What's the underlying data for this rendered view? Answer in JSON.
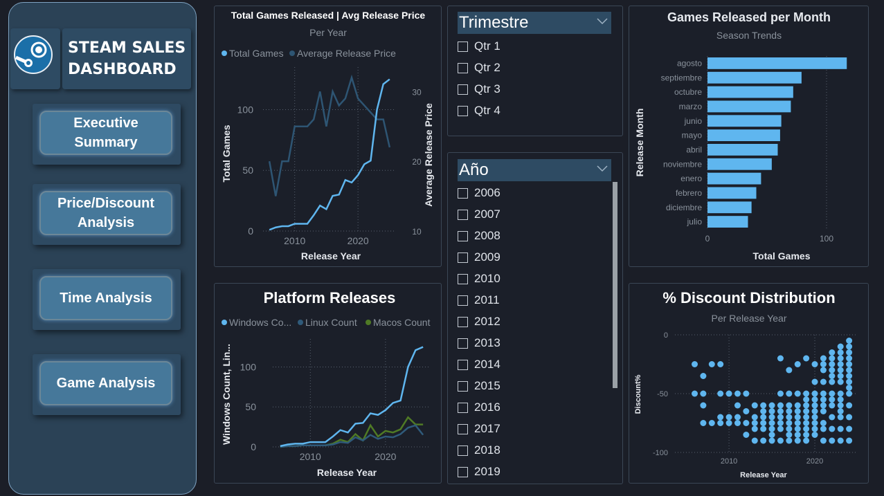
{
  "sidebar": {
    "logo_icon": "steam-logo-icon",
    "title": "STEAM SALES\nDASHBOARD",
    "nav": [
      {
        "label": "Executive Summary"
      },
      {
        "label": "Price/Discount Analysis"
      },
      {
        "label": "Time Analysis"
      },
      {
        "label": "Game Analysis"
      }
    ]
  },
  "trimestre": {
    "title": "Trimestre",
    "options": [
      "Qtr 1",
      "Qtr 2",
      "Qtr 3",
      "Qtr 4"
    ]
  },
  "anio": {
    "title": "Año",
    "options": [
      "2006",
      "2007",
      "2008",
      "2009",
      "2010",
      "2011",
      "2012",
      "2013",
      "2014",
      "2015",
      "2016",
      "2017",
      "2018",
      "2019"
    ]
  },
  "colors": {
    "total": "#5fb6ef",
    "price": "#2e5573",
    "windows": "#5fb6ef",
    "linux": "#2f5a7a",
    "macos": "#4f7a25",
    "accent_header": "#2e4b63"
  },
  "chart_data": [
    {
      "id": "total_games_price",
      "type": "line",
      "title": "Total Games Released | Avg Release Price",
      "subtitle": "Per Year",
      "xlabel": "Release Year",
      "ylabel": "Total Games",
      "ylabel2": "Average Release Price",
      "xlim": [
        2005,
        2026
      ],
      "ylim": [
        0,
        135
      ],
      "y2lim": [
        10,
        33.5
      ],
      "xticks": [
        "2010",
        "2020"
      ],
      "yticks": [
        "0",
        "50",
        "100"
      ],
      "y2ticks": [
        "10",
        "20",
        "30"
      ],
      "legend": [
        "Total Games",
        "Average Release Price"
      ],
      "legend_position": "top",
      "series": [
        {
          "name": "Total Games",
          "axis": "left",
          "x": [
            2006,
            2007,
            2008,
            2009,
            2010,
            2011,
            2012,
            2013,
            2014,
            2015,
            2016,
            2017,
            2018,
            2019,
            2020,
            2021,
            2022,
            2023,
            2024,
            2025
          ],
          "values": [
            1,
            3,
            4,
            4,
            6,
            6,
            6,
            13,
            21,
            18,
            29,
            30,
            42,
            40,
            46,
            55,
            58,
            100,
            121,
            125
          ]
        },
        {
          "name": "Average Release Price",
          "axis": "right",
          "x": [
            2006,
            2007,
            2008,
            2009,
            2010,
            2011,
            2012,
            2013,
            2014,
            2015,
            2016,
            2017,
            2018,
            2019,
            2020,
            2021,
            2022,
            2023,
            2024,
            2025
          ],
          "values": [
            20,
            15,
            20,
            20,
            25,
            25,
            25,
            26,
            30,
            25,
            30,
            28,
            29,
            32,
            29,
            28,
            27,
            26,
            26,
            22
          ]
        }
      ]
    },
    {
      "id": "platform_releases",
      "type": "line",
      "title": "Platform Releases",
      "xlabel": "Release Year",
      "ylabel": "Windows Count, Lin...",
      "xlim": [
        2005,
        2026
      ],
      "ylim": [
        0,
        135
      ],
      "xticks": [
        "2010",
        "2020"
      ],
      "yticks": [
        "0",
        "50",
        "100"
      ],
      "legend": [
        "Windows Co...",
        "Linux Count",
        "Macos Count"
      ],
      "legend_position": "top",
      "series": [
        {
          "name": "Windows Co...",
          "x": [
            2006,
            2007,
            2008,
            2009,
            2010,
            2011,
            2012,
            2013,
            2014,
            2015,
            2016,
            2017,
            2018,
            2019,
            2020,
            2021,
            2022,
            2023,
            2024,
            2025
          ],
          "values": [
            1,
            3,
            4,
            4,
            6,
            6,
            6,
            13,
            21,
            18,
            29,
            30,
            42,
            40,
            46,
            55,
            58,
            100,
            121,
            125
          ]
        },
        {
          "name": "Linux Count",
          "x": [
            2006,
            2007,
            2008,
            2009,
            2010,
            2011,
            2012,
            2013,
            2014,
            2015,
            2016,
            2017,
            2018,
            2019,
            2020,
            2021,
            2022,
            2023,
            2024,
            2025
          ],
          "values": [
            0,
            1,
            1,
            2,
            2,
            2,
            2,
            3,
            6,
            5,
            12,
            8,
            15,
            10,
            13,
            12,
            16,
            24,
            27,
            15
          ]
        },
        {
          "name": "Macos Count",
          "x": [
            2006,
            2007,
            2008,
            2009,
            2010,
            2011,
            2012,
            2013,
            2014,
            2015,
            2016,
            2017,
            2018,
            2019,
            2020,
            2021,
            2022,
            2023,
            2024,
            2025
          ],
          "values": [
            0,
            1,
            1,
            2,
            2,
            2,
            2,
            4,
            9,
            6,
            16,
            8,
            27,
            13,
            20,
            18,
            22,
            37,
            28,
            28
          ]
        }
      ]
    },
    {
      "id": "games_per_month",
      "type": "bar",
      "orientation": "horizontal",
      "title": "Games Released per Month",
      "subtitle": "Season Trends",
      "xlabel": "Total Games",
      "ylabel": "Release Month",
      "xlim": [
        0,
        125
      ],
      "xticks": [
        "0",
        "100"
      ],
      "categories": [
        "agosto",
        "septiembre",
        "octubre",
        "marzo",
        "junio",
        "mayo",
        "abril",
        "noviembre",
        "enero",
        "febrero",
        "diciembre",
        "julio"
      ],
      "values": [
        117,
        79,
        72,
        70,
        62,
        61,
        59,
        54,
        45,
        41,
        37,
        34
      ]
    },
    {
      "id": "discount_distribution",
      "type": "scatter",
      "title": "% Discount Distribution",
      "subtitle": "Per Release Year",
      "xlabel": "Release Year",
      "ylabel": "Discount%",
      "xlim": [
        2003.7,
        2025
      ],
      "ylim": [
        -100,
        0
      ],
      "xticks": [
        "2010",
        "2020"
      ],
      "yticks": [
        "0",
        "-50",
        "-100"
      ],
      "x": [
        2006,
        2006,
        2007,
        2007,
        2007,
        2007,
        2008,
        2008,
        2009,
        2009,
        2009,
        2009,
        2010,
        2010,
        2010,
        2011,
        2011,
        2011,
        2011,
        2012,
        2012,
        2012,
        2012,
        2013,
        2013,
        2013,
        2013,
        2013,
        2014,
        2014,
        2014,
        2014,
        2014,
        2014,
        2015,
        2015,
        2015,
        2015,
        2015,
        2015,
        2015,
        2016,
        2016,
        2016,
        2016,
        2016,
        2016,
        2016,
        2016,
        2017,
        2017,
        2017,
        2017,
        2017,
        2017,
        2017,
        2017,
        2017,
        2018,
        2018,
        2018,
        2018,
        2018,
        2018,
        2018,
        2018,
        2018,
        2019,
        2019,
        2019,
        2019,
        2019,
        2019,
        2019,
        2019,
        2019,
        2019,
        2020,
        2020,
        2020,
        2020,
        2020,
        2020,
        2020,
        2020,
        2020,
        2020,
        2021,
        2021,
        2021,
        2021,
        2021,
        2021,
        2021,
        2021,
        2021,
        2021,
        2021,
        2022,
        2022,
        2022,
        2022,
        2022,
        2022,
        2022,
        2022,
        2022,
        2022,
        2022,
        2022,
        2023,
        2023,
        2023,
        2023,
        2023,
        2023,
        2023,
        2023,
        2023,
        2023,
        2023,
        2023,
        2023,
        2023,
        2024,
        2024,
        2024,
        2024,
        2024,
        2024,
        2024,
        2024,
        2024,
        2024,
        2024,
        2024,
        2024,
        2024
      ],
      "y": [
        -25,
        -50,
        -35,
        -50,
        -60,
        -75,
        -25,
        -75,
        -25,
        -50,
        -70,
        -75,
        -50,
        -70,
        -75,
        -50,
        -60,
        -70,
        -75,
        -50,
        -65,
        -75,
        -85,
        -60,
        -70,
        -75,
        -80,
        -90,
        -60,
        -65,
        -70,
        -75,
        -80,
        -90,
        -60,
        -65,
        -70,
        -75,
        -80,
        -85,
        -90,
        -20,
        -50,
        -60,
        -65,
        -70,
        -75,
        -80,
        -90,
        -30,
        -50,
        -60,
        -65,
        -70,
        -75,
        -80,
        -85,
        -90,
        -25,
        -50,
        -60,
        -65,
        -70,
        -75,
        -80,
        -85,
        -90,
        -20,
        -50,
        -55,
        -60,
        -65,
        -70,
        -75,
        -80,
        -85,
        -90,
        -25,
        -40,
        -50,
        -55,
        -60,
        -65,
        -70,
        -75,
        -80,
        -85,
        -20,
        -25,
        -30,
        -40,
        -50,
        -55,
        -60,
        -65,
        -75,
        -80,
        -90,
        -15,
        -20,
        -25,
        -30,
        -35,
        -40,
        -50,
        -55,
        -60,
        -70,
        -80,
        -90,
        -10,
        -15,
        -20,
        -25,
        -30,
        -35,
        -40,
        -50,
        -55,
        -60,
        -65,
        -70,
        -80,
        -90,
        -5,
        -10,
        -15,
        -20,
        -25,
        -30,
        -35,
        -40,
        -45,
        -50,
        -60,
        -70,
        -80,
        -90
      ]
    }
  ]
}
